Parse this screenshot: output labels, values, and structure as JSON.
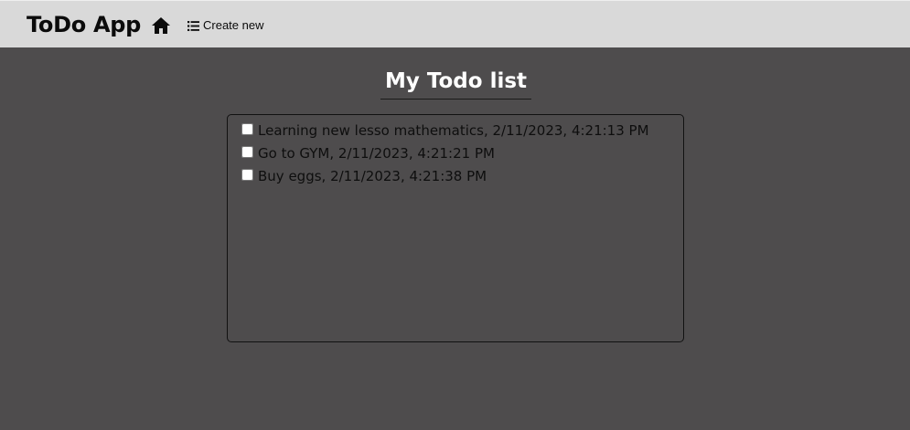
{
  "app": {
    "brand": "ToDo App"
  },
  "nav": {
    "home_icon": "home-icon",
    "create_icon": "list-icon",
    "create_label": "Create new"
  },
  "main": {
    "title": "My Todo list",
    "todos": [
      {
        "text": "Learning new lesso mathematics, 2/11/2023, 4:21:13 PM",
        "checked": false
      },
      {
        "text": "Go to GYM, 2/11/2023, 4:21:21 PM",
        "checked": false
      },
      {
        "text": "Buy eggs, 2/11/2023, 4:21:38 PM",
        "checked": false
      }
    ]
  },
  "colors": {
    "background": "#4e4c4d",
    "navbar": "#d9d9d9",
    "title_text": "#ffffff",
    "item_text": "#0e0e0e"
  }
}
